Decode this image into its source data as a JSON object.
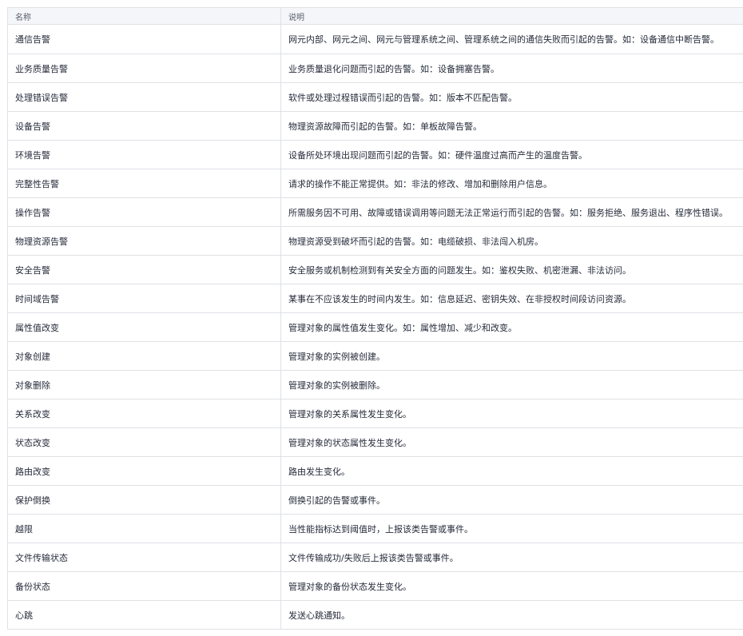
{
  "table": {
    "headers": {
      "name": "名称",
      "description": "说明"
    },
    "rows": [
      {
        "name": "通信告警",
        "description": "网元内部、网元之间、网元与管理系统之间、管理系统之间的通信失败而引起的告警。如：设备通信中断告警。"
      },
      {
        "name": "业务质量告警",
        "description": "业务质量退化问题而引起的告警。如：设备拥塞告警。"
      },
      {
        "name": "处理错误告警",
        "description": "软件或处理过程错误而引起的告警。如：版本不匹配告警。"
      },
      {
        "name": "设备告警",
        "description": "物理资源故障而引起的告警。如：单板故障告警。"
      },
      {
        "name": "环境告警",
        "description": "设备所处环境出现问题而引起的告警。如：硬件温度过高而产生的温度告警。"
      },
      {
        "name": "完整性告警",
        "description": "请求的操作不能正常提供。如：非法的修改、增加和删除用户信息。"
      },
      {
        "name": "操作告警",
        "description": "所需服务因不可用、故障或错误调用等问题无法正常运行而引起的告警。如：服务拒绝、服务退出、程序性错误。"
      },
      {
        "name": "物理资源告警",
        "description": "物理资源受到破坏而引起的告警。如：电缆破损、非法闯入机房。"
      },
      {
        "name": "安全告警",
        "description": "安全服务或机制检测到有关安全方面的问题发生。如：鉴权失败、机密泄漏、非法访问。"
      },
      {
        "name": "时间域告警",
        "description": "某事在不应该发生的时间内发生。如：信息延迟、密钥失效、在非授权时间段访问资源。"
      },
      {
        "name": "属性值改变",
        "description": "管理对象的属性值发生变化。如：属性增加、减少和改变。"
      },
      {
        "name": "对象创建",
        "description": "管理对象的实例被创建。"
      },
      {
        "name": "对象删除",
        "description": "管理对象的实例被删除。"
      },
      {
        "name": "关系改变",
        "description": "管理对象的关系属性发生变化。"
      },
      {
        "name": "状态改变",
        "description": "管理对象的状态属性发生变化。"
      },
      {
        "name": "路由改变",
        "description": "路由发生变化。"
      },
      {
        "name": "保护倒换",
        "description": "倒换引起的告警或事件。"
      },
      {
        "name": "越限",
        "description": "当性能指标达到阈值时，上报该类告警或事件。"
      },
      {
        "name": "文件传输状态",
        "description": "文件传输成功/失败后上报该类告警或事件。"
      },
      {
        "name": "备份状态",
        "description": "管理对象的备份状态发生变化。"
      },
      {
        "name": "心跳",
        "description": "发送心跳通知。"
      }
    ]
  }
}
